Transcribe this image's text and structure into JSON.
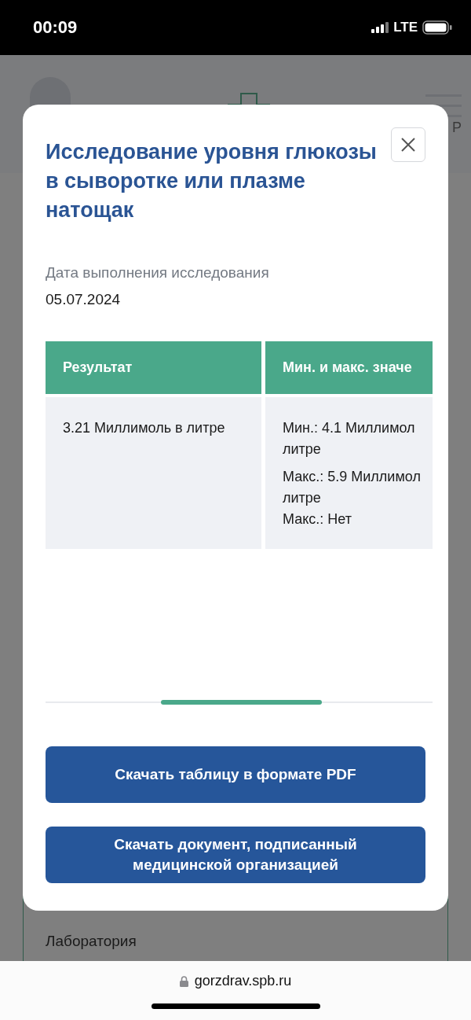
{
  "status_bar": {
    "time": "00:09",
    "network": "LTE"
  },
  "background_page": {
    "header": {
      "right_label": "Р"
    },
    "card": {
      "department": "Лаборатория"
    }
  },
  "modal": {
    "title": "Исследование уровня глюкозы в сыворотке или плазме натощак",
    "date_label": "Дата выполнения исследования",
    "date_value": "05.07.2024",
    "table": {
      "columns": [
        "Результат",
        "Мин. и макс. значе"
      ],
      "rows": [
        {
          "cells": [
            [
              "3.21 Миллимоль в литре"
            ],
            [
              "Мин.: 4.1 Миллимол",
              "литре",
              "Макс.: 5.9 Миллимол",
              "литре",
              "Макс.: Нет"
            ]
          ]
        }
      ]
    },
    "buttons": [
      {
        "label": "Скачать таблицу в формате PDF"
      },
      {
        "label": "Скачать документ, подписанный медицинской организацией"
      }
    ]
  },
  "browser_bar": {
    "url": "gorzdrav.spb.ru"
  }
}
